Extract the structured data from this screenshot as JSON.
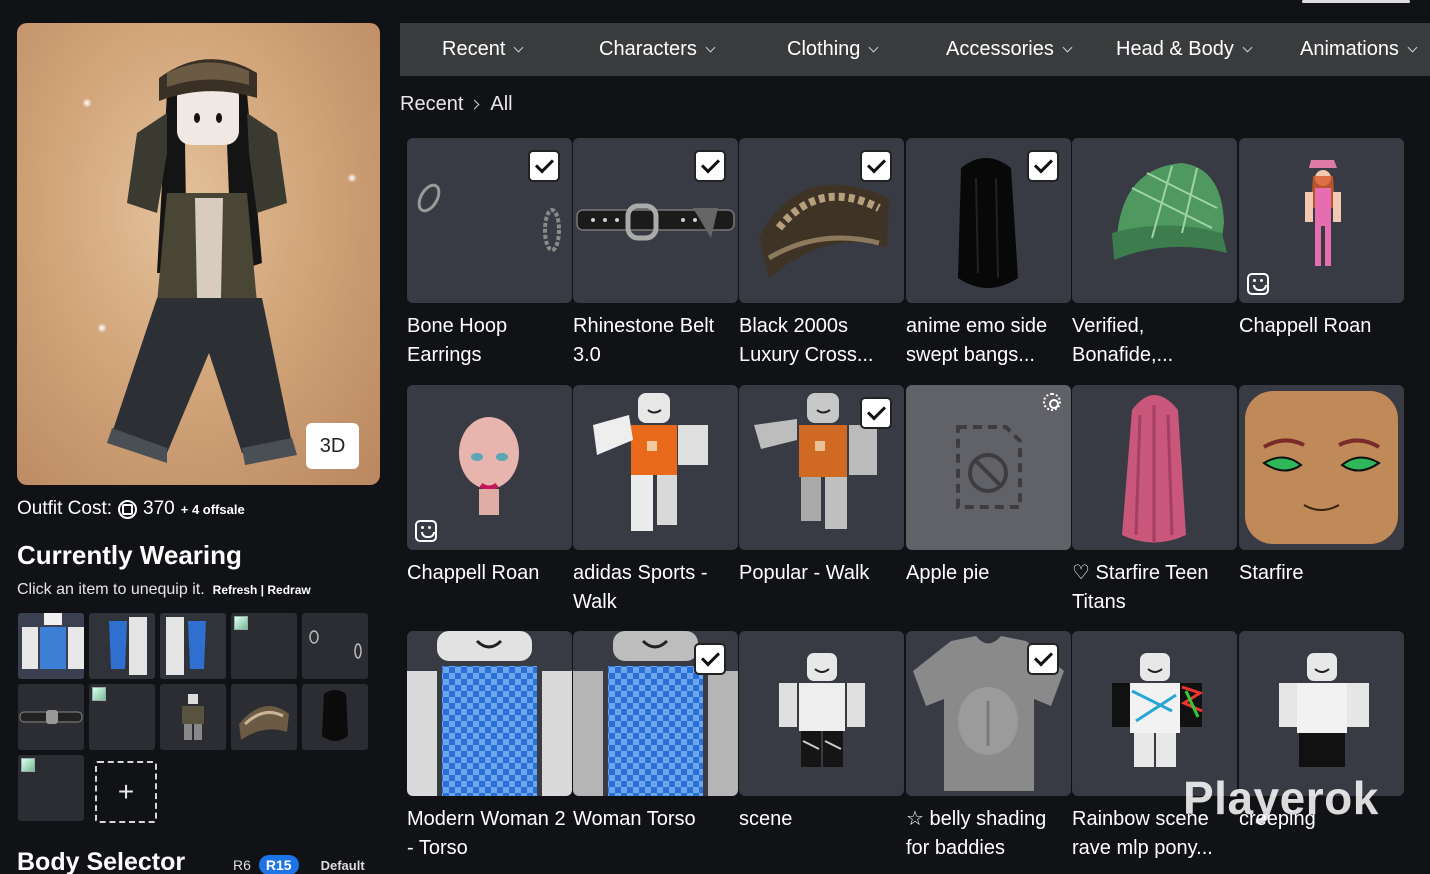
{
  "left": {
    "view_3d_label": "3D",
    "outfit_cost_label": "Outfit Cost:",
    "outfit_cost_value": "370",
    "offsale_note": "+ 4 offsale",
    "currently_wearing_title": "Currently Wearing",
    "currently_wearing_hint": "Click an item to unequip it.",
    "refresh_redraw": "Refresh | Redraw",
    "add_item_symbol": "+",
    "body_selector_title": "Body Selector",
    "rig_r6": "R6",
    "rig_r15": "R15",
    "rig_default": "Default"
  },
  "categories": [
    "Recent",
    "Characters",
    "Clothing",
    "Accessories",
    "Head & Body",
    "Animations"
  ],
  "breadcrumb": {
    "parent": "Recent",
    "current": "All"
  },
  "items": [
    {
      "name": "Bone Hoop Earrings",
      "equipped": true
    },
    {
      "name": "Rhinestone Belt 3.0",
      "equipped": true
    },
    {
      "name": "Black 2000s Luxury Cross...",
      "equipped": true
    },
    {
      "name": "anime emo side swept bangs...",
      "equipped": true
    },
    {
      "name": "Verified, Bonafide,...",
      "equipped": false
    },
    {
      "name": "Chappell Roan",
      "equipped": false
    },
    {
      "name": "Chappell Roan",
      "equipped": false
    },
    {
      "name": "adidas Sports - Walk",
      "equipped": false
    },
    {
      "name": "Popular - Walk",
      "equipped": true
    },
    {
      "name": "Apple pie",
      "equipped": false
    },
    {
      "name": "♡ Starfire Teen Titans",
      "equipped": false
    },
    {
      "name": "Starfire",
      "equipped": false
    },
    {
      "name": "Modern Woman 2 - Torso",
      "equipped": false
    },
    {
      "name": "Woman Torso",
      "equipped": true
    },
    {
      "name": "scene",
      "equipped": false
    },
    {
      "name": "☆ belly shading for baddies",
      "equipped": true
    },
    {
      "name": "Rainbow scene rave mlp pony...",
      "equipped": false
    },
    {
      "name": "creeping",
      "equipped": false
    }
  ],
  "watermark": "Playerok"
}
